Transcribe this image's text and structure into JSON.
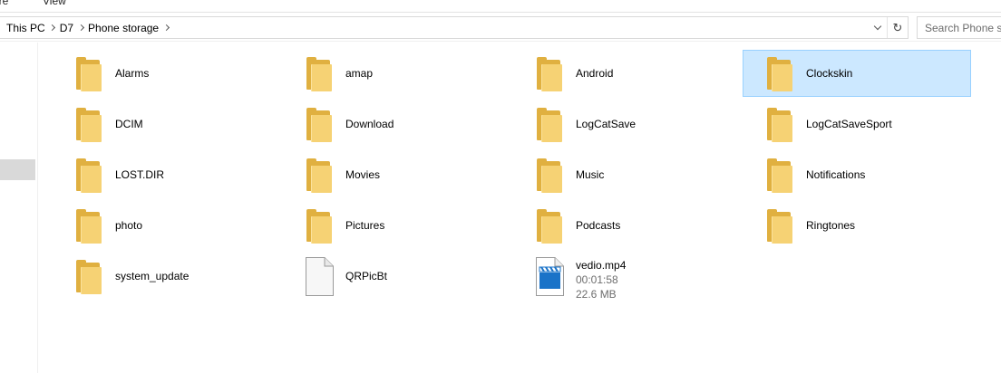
{
  "ribbon": {
    "tabs": [
      "are",
      "View"
    ]
  },
  "address": {
    "crumbs": [
      "This PC",
      "D7",
      "Phone storage"
    ],
    "refresh_glyph": "↻"
  },
  "search": {
    "placeholder": "Search Phone st"
  },
  "colors": {
    "selection_bg": "#cce8ff",
    "selection_border": "#99d1ff",
    "folder_front": "#f6d274",
    "folder_back": "#e0b040",
    "video_blue": "#1a73c8"
  },
  "items": [
    {
      "name": "Alarms",
      "type": "folder",
      "icon": "folder-icon"
    },
    {
      "name": "amap",
      "type": "folder",
      "icon": "folder-icon"
    },
    {
      "name": "Android",
      "type": "folder",
      "icon": "folder-icon"
    },
    {
      "name": "Clockskin",
      "type": "folder",
      "icon": "folder-icon",
      "selected": true
    },
    {
      "name": "DCIM",
      "type": "folder",
      "icon": "folder-icon"
    },
    {
      "name": "Download",
      "type": "folder",
      "icon": "folder-icon"
    },
    {
      "name": "LogCatSave",
      "type": "folder",
      "icon": "folder-icon"
    },
    {
      "name": "LogCatSaveSport",
      "type": "folder",
      "icon": "folder-icon"
    },
    {
      "name": "LOST.DIR",
      "type": "folder",
      "icon": "folder-icon"
    },
    {
      "name": "Movies",
      "type": "folder",
      "icon": "folder-icon"
    },
    {
      "name": "Music",
      "type": "folder",
      "icon": "folder-icon"
    },
    {
      "name": "Notifications",
      "type": "folder",
      "icon": "folder-icon"
    },
    {
      "name": "photo",
      "type": "folder",
      "icon": "folder-icon"
    },
    {
      "name": "Pictures",
      "type": "folder",
      "icon": "folder-icon"
    },
    {
      "name": "Podcasts",
      "type": "folder",
      "icon": "folder-icon"
    },
    {
      "name": "Ringtones",
      "type": "folder",
      "icon": "folder-icon"
    },
    {
      "name": "system_update",
      "type": "folder",
      "icon": "folder-icon"
    },
    {
      "name": "QRPicBt",
      "type": "file",
      "icon": "file-icon"
    },
    {
      "name": "vedio.mp4",
      "type": "video",
      "icon": "video-file-icon",
      "duration": "00:01:58",
      "size": "22.6 MB"
    }
  ]
}
